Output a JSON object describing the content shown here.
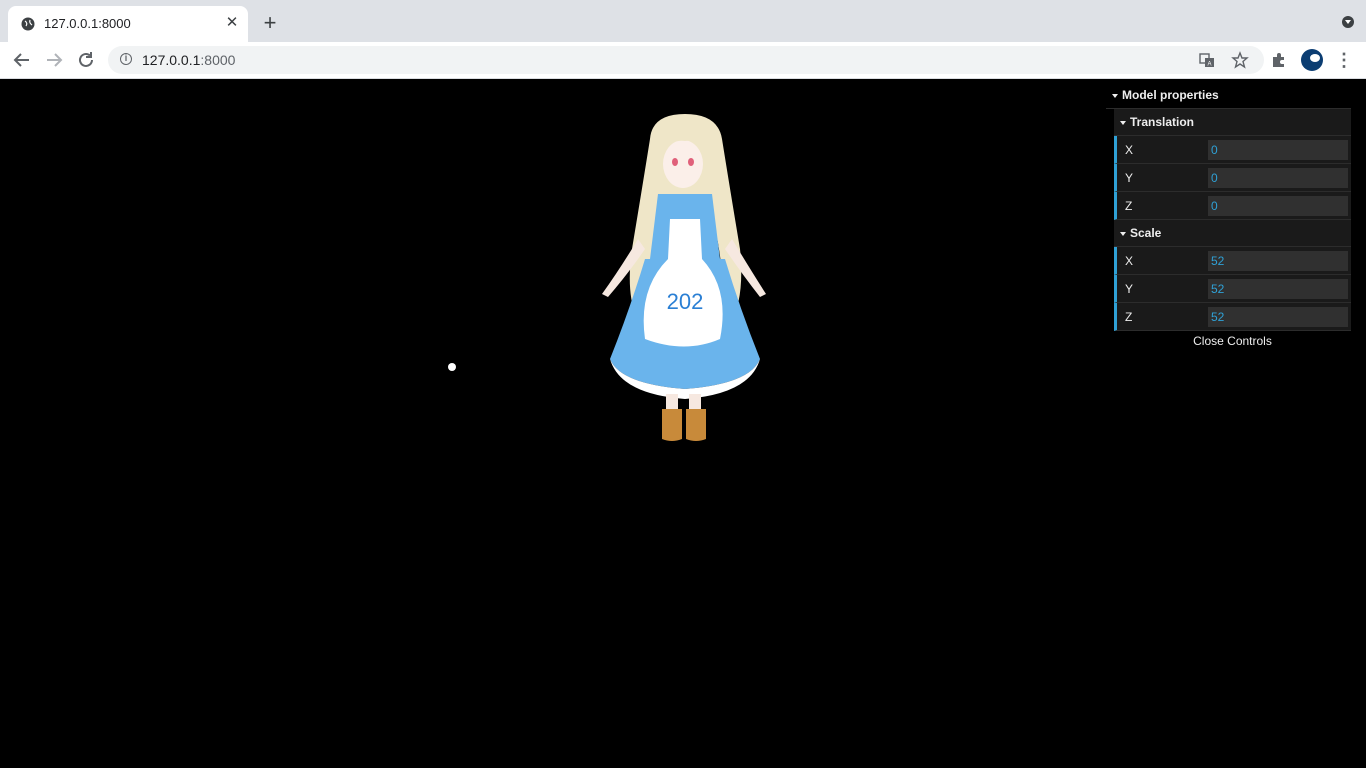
{
  "browser": {
    "tab_title": "127.0.0.1:8000",
    "tab_close": "✕",
    "new_tab": "+",
    "url_host": "127.0.0.1",
    "url_port": ":8000"
  },
  "gui": {
    "root_title": "Model properties",
    "translation": {
      "title": "Translation",
      "rows": [
        {
          "label": "X",
          "value": "0"
        },
        {
          "label": "Y",
          "value": "0"
        },
        {
          "label": "Z",
          "value": "0"
        }
      ]
    },
    "scale": {
      "title": "Scale",
      "rows": [
        {
          "label": "X",
          "value": "52"
        },
        {
          "label": "Y",
          "value": "52"
        },
        {
          "label": "Z",
          "value": "52"
        }
      ]
    },
    "close_label": "Close Controls"
  },
  "model": {
    "apron_text": "202"
  },
  "colors": {
    "accent": "#2fa1d6",
    "dress": "#6ab4ec"
  }
}
